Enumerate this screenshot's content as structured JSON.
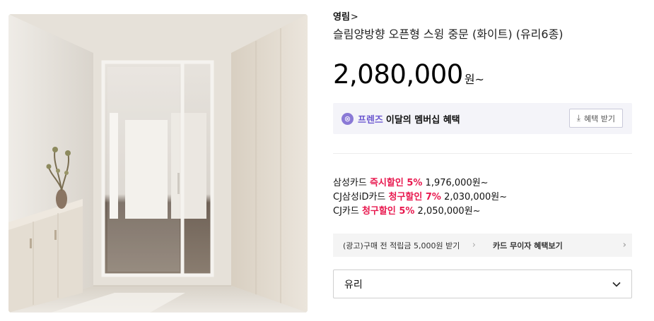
{
  "product": {
    "brand": "영림",
    "brand_chevron": ">",
    "title": "슬림양방향 오픈형 스윙 중문 (화이트) (유리6종)",
    "price": "2,080,000",
    "price_unit": "원~",
    "image_alt": "슬림양방향 오픈형 스윙 중문 제품 이미지"
  },
  "membership": {
    "icon": "friends-badge-icon",
    "label": "프렌즈",
    "text": "이달의 멤버십 혜택",
    "button_label": "혜택 받기",
    "button_icon": "download-icon"
  },
  "card_discounts": [
    {
      "card": "삼성카드 ",
      "type": "즉시할인 5%",
      "price": " 1,976,000원~"
    },
    {
      "card": "CJ삼성iD카드 ",
      "type": "청구할인 7%",
      "price": " 2,030,000원~"
    },
    {
      "card": "CJ카드 ",
      "type": "청구할인 5%",
      "price": " 2,050,000원~"
    }
  ],
  "promo": {
    "left": "(광고)구매 전 적립금 5,000원 받기",
    "right": "카드 무이자 혜택보기",
    "arrow": "›"
  },
  "option_select": {
    "value": "유리"
  },
  "colors": {
    "discount": "#e8194f",
    "friends": "#6b57d0",
    "membership_bg": "#f4f4f9"
  }
}
